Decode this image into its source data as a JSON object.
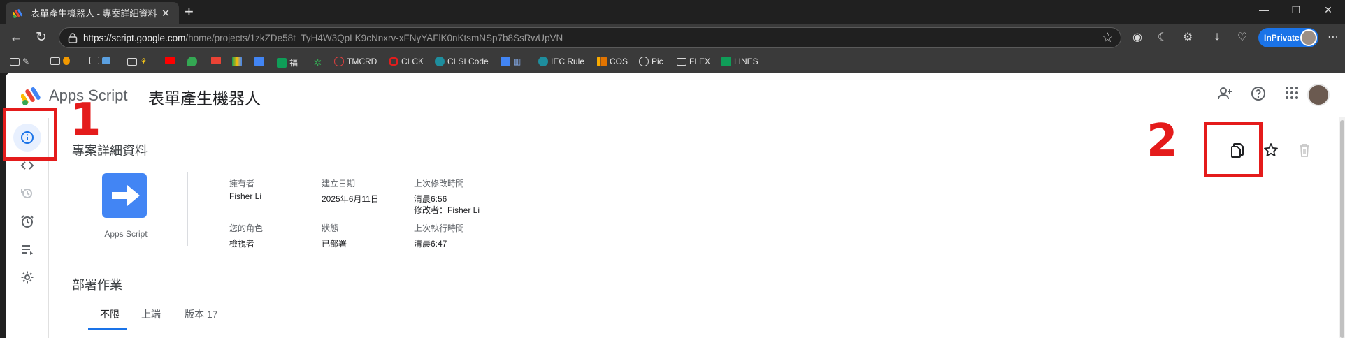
{
  "browser": {
    "tab_title": "表單產生機器人 - 專案詳細資料 -",
    "tab_close": "✕",
    "new_tab": "+",
    "window_controls": [
      "—",
      "❐",
      "✕"
    ],
    "url_host": "https://script.google.com",
    "url_path": "/home/projects/1zkZDe58t_TyH4W3QpLK9cNnxrv-xFNyYAFlK0nKtsmNSp7b8SsRwUpVN",
    "inprivate_label": "InPrivate",
    "more": "⋯"
  },
  "bookmarks": [
    {
      "label": "",
      "icon": "folder-icon"
    },
    {
      "label": "",
      "icon": "folder-icon"
    },
    {
      "label": "",
      "icon": "folder-icon"
    },
    {
      "label": "",
      "icon": "folder-icon"
    },
    {
      "label": "",
      "icon": "youtube-icon"
    },
    {
      "label": "",
      "icon": "maps-icon"
    },
    {
      "label": "",
      "icon": "gmail-icon"
    },
    {
      "label": "",
      "icon": "drive-icon"
    },
    {
      "label": "",
      "icon": "calendar-icon"
    },
    {
      "label": "福",
      "icon": "sheets-icon"
    },
    {
      "label": "",
      "icon": "plant-icon"
    },
    {
      "label": "TMCRD",
      "icon": "clock-icon"
    },
    {
      "label": "CLCK",
      "icon": "oracle-icon"
    },
    {
      "label": "CLSI Code",
      "icon": "s-icon"
    },
    {
      "label": "",
      "icon": "docs-icon"
    },
    {
      "label": "IEC Rule",
      "icon": "s-icon"
    },
    {
      "label": "COS",
      "icon": "chart-icon"
    },
    {
      "label": "Pic",
      "icon": "globe-icon"
    },
    {
      "label": "FLEX",
      "icon": "folder-icon"
    },
    {
      "label": "LINES",
      "icon": "sheets-icon"
    }
  ],
  "header": {
    "brand": "Apps Script",
    "project_title": "表單產生機器人"
  },
  "overview": {
    "section_title": "專案詳細資料",
    "icon_label": "Apps Script",
    "owner_label": "擁有者",
    "owner_value": "Fisher Li",
    "created_label": "建立日期",
    "created_value": "2025年6月11日",
    "modified_label": "上次修改時間",
    "modified_value": "清晨6:56",
    "modified_by": "修改者：Fisher Li",
    "role_label": "您的角色",
    "role_value": "檢視者",
    "status_label": "狀態",
    "status_value": "已部署",
    "last_run_label": "上次執行時間",
    "last_run_value": "清晨6:47"
  },
  "deployments": {
    "section_title": "部署作業",
    "tabs": [
      "不限",
      "上端",
      "版本 17"
    ],
    "selected_tab": "不限"
  },
  "annotations": {
    "one": "1",
    "two": "2",
    "color": "#e41b1b"
  },
  "colors": {
    "accent": "#1a73e8",
    "apps_script_blue": "#4285f4"
  }
}
